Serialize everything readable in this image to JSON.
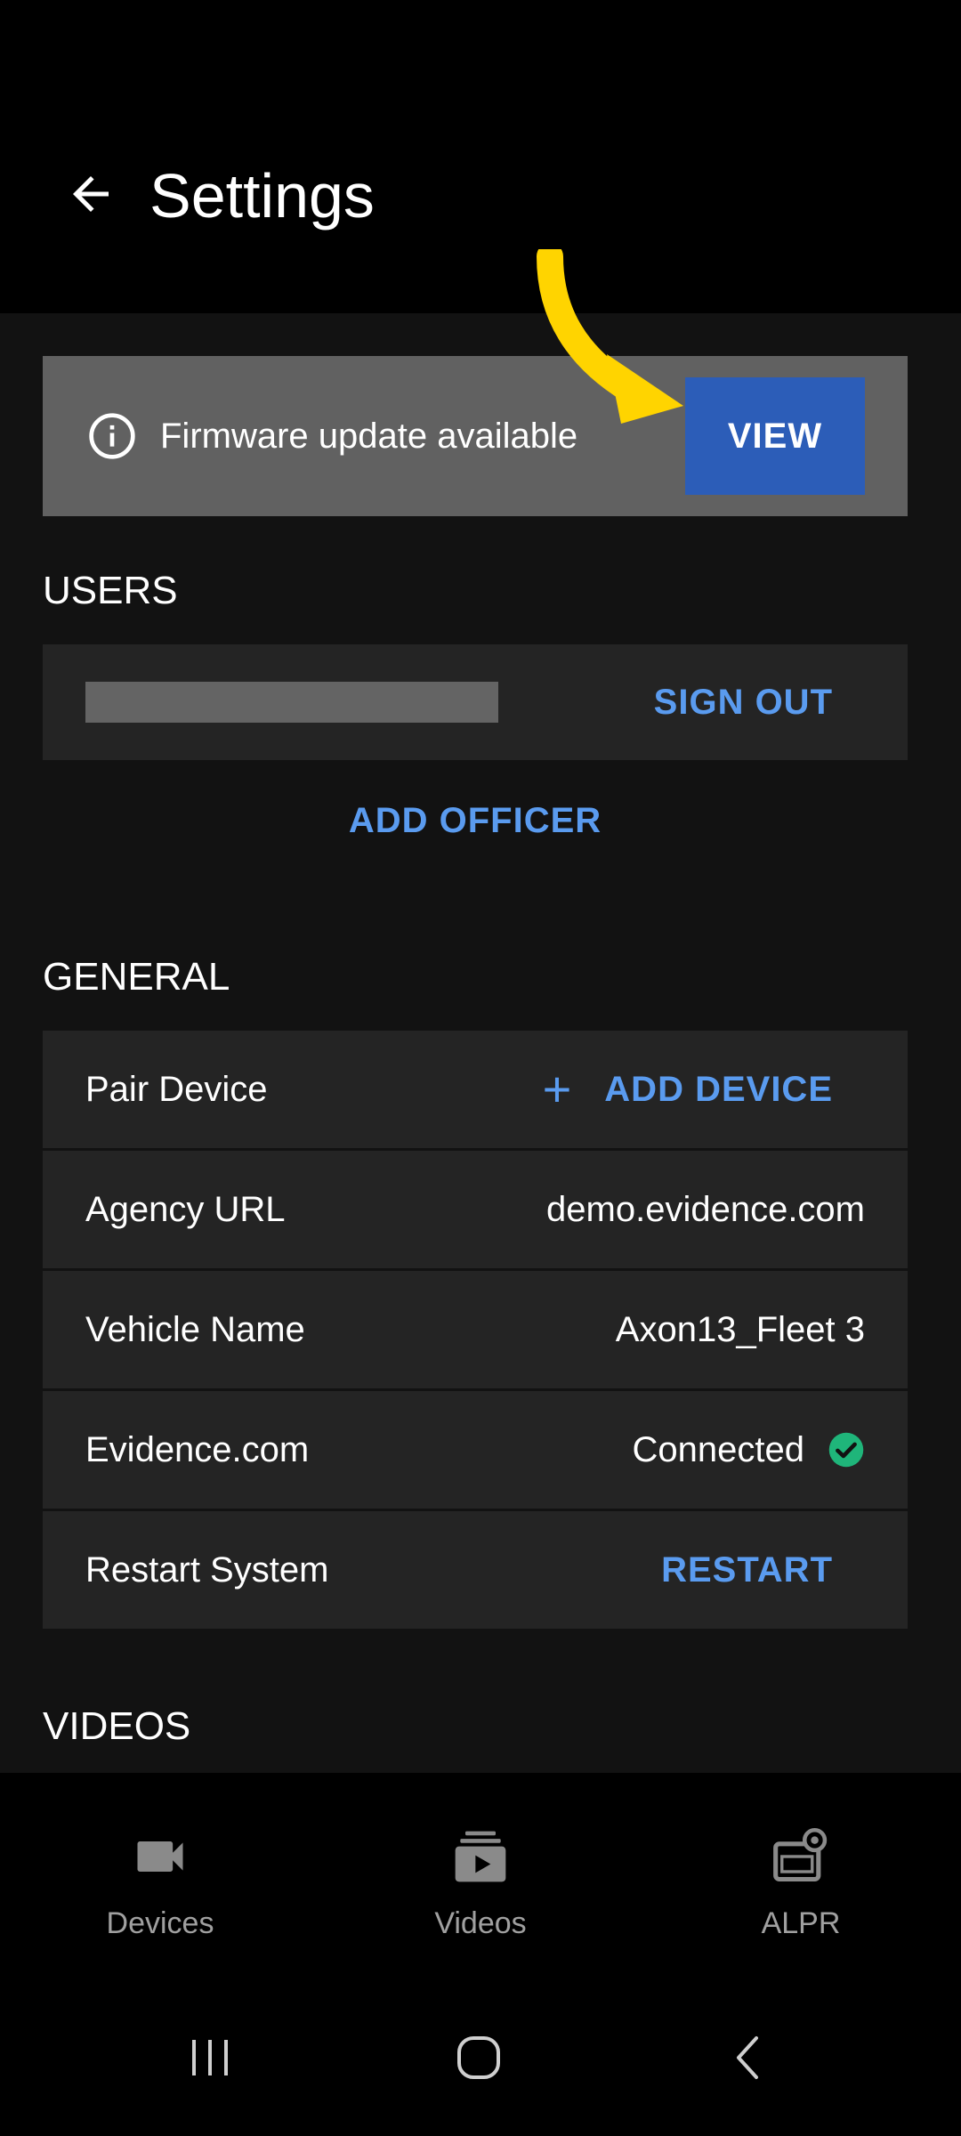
{
  "header": {
    "title": "Settings"
  },
  "banner": {
    "text": "Firmware update available",
    "action": "VIEW"
  },
  "users": {
    "section_title": "USERS",
    "sign_out_label": "SIGN OUT",
    "add_officer_label": "ADD OFFICER"
  },
  "general": {
    "section_title": "GENERAL",
    "rows": [
      {
        "label": "Pair Device",
        "action": "ADD DEVICE"
      },
      {
        "label": "Agency URL",
        "value": "demo.evidence.com"
      },
      {
        "label": "Vehicle Name",
        "value": "Axon13_Fleet 3"
      },
      {
        "label": "Evidence.com",
        "value": "Connected",
        "status": "connected"
      },
      {
        "label": "Restart System",
        "action": "RESTART"
      }
    ]
  },
  "videos": {
    "section_title": "VIDEOS"
  },
  "bottom_nav": [
    {
      "label": "Devices",
      "icon": "video-camera-icon"
    },
    {
      "label": "Videos",
      "icon": "video-library-icon"
    },
    {
      "label": "ALPR",
      "icon": "alpr-camera-icon"
    }
  ],
  "colors": {
    "accent": "#5a9bef",
    "primary_button": "#2c5db8",
    "banner_bg": "#616161",
    "success": "#1fb57a",
    "arrow": "#ffd400"
  }
}
